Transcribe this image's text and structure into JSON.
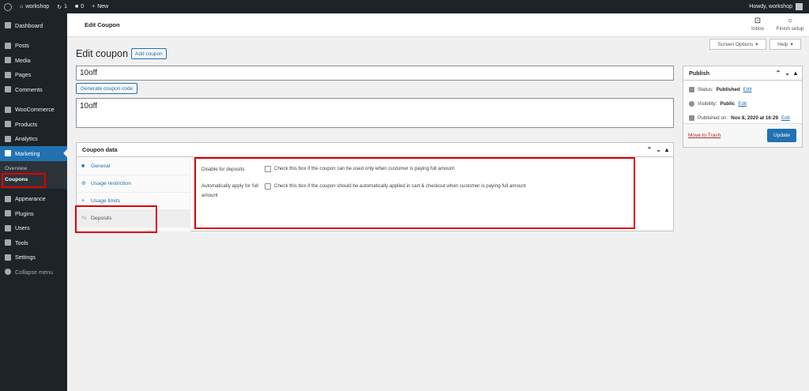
{
  "adminbar": {
    "site_name": "workshop",
    "updates_count": "1",
    "comments_count": "0",
    "new_label": "New",
    "howdy": "Howdy, workshop"
  },
  "sidebar": {
    "items": [
      {
        "label": "Dashboard",
        "icon": "dashboard-icon"
      },
      {
        "label": "Posts",
        "icon": "pin-icon"
      },
      {
        "label": "Media",
        "icon": "media-icon"
      },
      {
        "label": "Pages",
        "icon": "pages-icon"
      },
      {
        "label": "Comments",
        "icon": "comment-icon"
      },
      {
        "label": "WooCommerce",
        "icon": "woo-icon"
      },
      {
        "label": "Products",
        "icon": "archive-icon"
      },
      {
        "label": "Analytics",
        "icon": "chart-bar-icon"
      },
      {
        "label": "Marketing",
        "icon": "megaphone-icon"
      },
      {
        "label": "Appearance",
        "icon": "brush-icon"
      },
      {
        "label": "Plugins",
        "icon": "plugin-icon"
      },
      {
        "label": "Users",
        "icon": "users-icon"
      },
      {
        "label": "Tools",
        "icon": "wrench-icon"
      },
      {
        "label": "Settings",
        "icon": "settings-icon"
      },
      {
        "label": "Collapse menu",
        "icon": "collapse-icon"
      }
    ],
    "submenu": [
      "Overview",
      "Coupons"
    ]
  },
  "header": {
    "title": "Edit Coupon",
    "inbox_label": "Inbox",
    "finish_setup_label": "Finish setup"
  },
  "screen_options": "Screen Options",
  "help": "Help",
  "page": {
    "title": "Edit coupon",
    "add_coupon": "Add coupon",
    "coupon_code": "10off",
    "generate_code": "Generate coupon code",
    "description": "10off"
  },
  "coupon_data": {
    "title": "Coupon data",
    "tabs": [
      {
        "label": "General",
        "icon": "ticket-icon"
      },
      {
        "label": "Usage restriction",
        "icon": "block-icon"
      },
      {
        "label": "Usage limits",
        "icon": "plus-icon"
      },
      {
        "label": "Deposits",
        "icon": "percent-icon"
      }
    ],
    "fields": [
      {
        "label": "Disable for deposits",
        "description": "Check this box if the coupon can be used only when customer is paying full amount"
      },
      {
        "label": "Automatically apply for full amount",
        "description": "Check this box if the coupon should be automatically applied in cart & checkout when customer is paying full amount"
      }
    ]
  },
  "publish": {
    "title": "Publish",
    "status_label": "Status:",
    "status_value": "Published",
    "visibility_label": "Visibility:",
    "visibility_value": "Public",
    "published_label": "Published on:",
    "published_value": "Nov 8, 2020 at 16:29",
    "edit": "Edit",
    "trash": "Move to Trash",
    "update": "Update"
  },
  "colors": {
    "admin_dark": "#1d2327",
    "accent": "#2271b1",
    "highlight": "#e00000"
  }
}
